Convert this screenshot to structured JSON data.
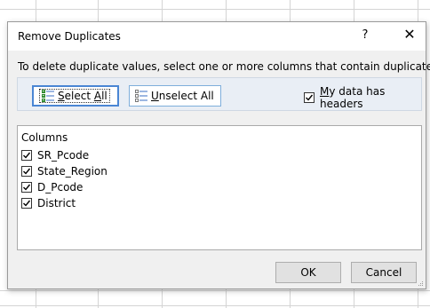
{
  "dialog": {
    "title": "Remove Duplicates",
    "help_label": "?",
    "close_label": "✕",
    "instruction": "To delete duplicate values, select one or more columns that contain duplicates.",
    "select_all": {
      "accel": "S",
      "rest": "elect ",
      "tail_accel": "A",
      "tail": "ll"
    },
    "unselect_all": {
      "accel": "U",
      "rest": "nselect All"
    },
    "headers_checkbox": {
      "accel": "M",
      "rest": "y data has headers",
      "checked": true
    },
    "columns_header": "Columns",
    "columns": [
      {
        "label": "SR_Pcode",
        "checked": true
      },
      {
        "label": "State_Region",
        "checked": true
      },
      {
        "label": "D_Pcode",
        "checked": true
      },
      {
        "label": "District",
        "checked": true
      }
    ],
    "ok_label": "OK",
    "cancel_label": "Cancel"
  },
  "colors": {
    "dialog_bg": "#f0f0f0",
    "toolbar_bg": "#e9eef5",
    "focus_border": "#4a86d4",
    "grid_line": "#d4d4d4"
  }
}
